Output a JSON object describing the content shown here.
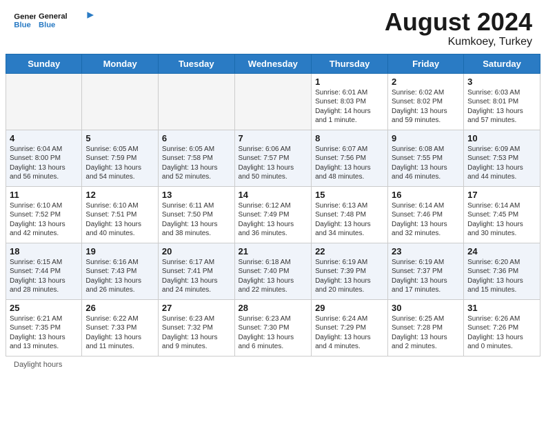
{
  "header": {
    "logo_line1": "General",
    "logo_line2": "Blue",
    "month_year": "August 2024",
    "location": "Kumkoey, Turkey"
  },
  "weekdays": [
    "Sunday",
    "Monday",
    "Tuesday",
    "Wednesday",
    "Thursday",
    "Friday",
    "Saturday"
  ],
  "footer": {
    "daylight_label": "Daylight hours"
  },
  "weeks": [
    [
      {
        "day": "",
        "info": ""
      },
      {
        "day": "",
        "info": ""
      },
      {
        "day": "",
        "info": ""
      },
      {
        "day": "",
        "info": ""
      },
      {
        "day": "1",
        "info": "Sunrise: 6:01 AM\nSunset: 8:03 PM\nDaylight: 14 hours\nand 1 minute."
      },
      {
        "day": "2",
        "info": "Sunrise: 6:02 AM\nSunset: 8:02 PM\nDaylight: 13 hours\nand 59 minutes."
      },
      {
        "day": "3",
        "info": "Sunrise: 6:03 AM\nSunset: 8:01 PM\nDaylight: 13 hours\nand 57 minutes."
      }
    ],
    [
      {
        "day": "4",
        "info": "Sunrise: 6:04 AM\nSunset: 8:00 PM\nDaylight: 13 hours\nand 56 minutes."
      },
      {
        "day": "5",
        "info": "Sunrise: 6:05 AM\nSunset: 7:59 PM\nDaylight: 13 hours\nand 54 minutes."
      },
      {
        "day": "6",
        "info": "Sunrise: 6:05 AM\nSunset: 7:58 PM\nDaylight: 13 hours\nand 52 minutes."
      },
      {
        "day": "7",
        "info": "Sunrise: 6:06 AM\nSunset: 7:57 PM\nDaylight: 13 hours\nand 50 minutes."
      },
      {
        "day": "8",
        "info": "Sunrise: 6:07 AM\nSunset: 7:56 PM\nDaylight: 13 hours\nand 48 minutes."
      },
      {
        "day": "9",
        "info": "Sunrise: 6:08 AM\nSunset: 7:55 PM\nDaylight: 13 hours\nand 46 minutes."
      },
      {
        "day": "10",
        "info": "Sunrise: 6:09 AM\nSunset: 7:53 PM\nDaylight: 13 hours\nand 44 minutes."
      }
    ],
    [
      {
        "day": "11",
        "info": "Sunrise: 6:10 AM\nSunset: 7:52 PM\nDaylight: 13 hours\nand 42 minutes."
      },
      {
        "day": "12",
        "info": "Sunrise: 6:10 AM\nSunset: 7:51 PM\nDaylight: 13 hours\nand 40 minutes."
      },
      {
        "day": "13",
        "info": "Sunrise: 6:11 AM\nSunset: 7:50 PM\nDaylight: 13 hours\nand 38 minutes."
      },
      {
        "day": "14",
        "info": "Sunrise: 6:12 AM\nSunset: 7:49 PM\nDaylight: 13 hours\nand 36 minutes."
      },
      {
        "day": "15",
        "info": "Sunrise: 6:13 AM\nSunset: 7:48 PM\nDaylight: 13 hours\nand 34 minutes."
      },
      {
        "day": "16",
        "info": "Sunrise: 6:14 AM\nSunset: 7:46 PM\nDaylight: 13 hours\nand 32 minutes."
      },
      {
        "day": "17",
        "info": "Sunrise: 6:14 AM\nSunset: 7:45 PM\nDaylight: 13 hours\nand 30 minutes."
      }
    ],
    [
      {
        "day": "18",
        "info": "Sunrise: 6:15 AM\nSunset: 7:44 PM\nDaylight: 13 hours\nand 28 minutes."
      },
      {
        "day": "19",
        "info": "Sunrise: 6:16 AM\nSunset: 7:43 PM\nDaylight: 13 hours\nand 26 minutes."
      },
      {
        "day": "20",
        "info": "Sunrise: 6:17 AM\nSunset: 7:41 PM\nDaylight: 13 hours\nand 24 minutes."
      },
      {
        "day": "21",
        "info": "Sunrise: 6:18 AM\nSunset: 7:40 PM\nDaylight: 13 hours\nand 22 minutes."
      },
      {
        "day": "22",
        "info": "Sunrise: 6:19 AM\nSunset: 7:39 PM\nDaylight: 13 hours\nand 20 minutes."
      },
      {
        "day": "23",
        "info": "Sunrise: 6:19 AM\nSunset: 7:37 PM\nDaylight: 13 hours\nand 17 minutes."
      },
      {
        "day": "24",
        "info": "Sunrise: 6:20 AM\nSunset: 7:36 PM\nDaylight: 13 hours\nand 15 minutes."
      }
    ],
    [
      {
        "day": "25",
        "info": "Sunrise: 6:21 AM\nSunset: 7:35 PM\nDaylight: 13 hours\nand 13 minutes."
      },
      {
        "day": "26",
        "info": "Sunrise: 6:22 AM\nSunset: 7:33 PM\nDaylight: 13 hours\nand 11 minutes."
      },
      {
        "day": "27",
        "info": "Sunrise: 6:23 AM\nSunset: 7:32 PM\nDaylight: 13 hours\nand 9 minutes."
      },
      {
        "day": "28",
        "info": "Sunrise: 6:23 AM\nSunset: 7:30 PM\nDaylight: 13 hours\nand 6 minutes."
      },
      {
        "day": "29",
        "info": "Sunrise: 6:24 AM\nSunset: 7:29 PM\nDaylight: 13 hours\nand 4 minutes."
      },
      {
        "day": "30",
        "info": "Sunrise: 6:25 AM\nSunset: 7:28 PM\nDaylight: 13 hours\nand 2 minutes."
      },
      {
        "day": "31",
        "info": "Sunrise: 6:26 AM\nSunset: 7:26 PM\nDaylight: 13 hours\nand 0 minutes."
      }
    ]
  ]
}
